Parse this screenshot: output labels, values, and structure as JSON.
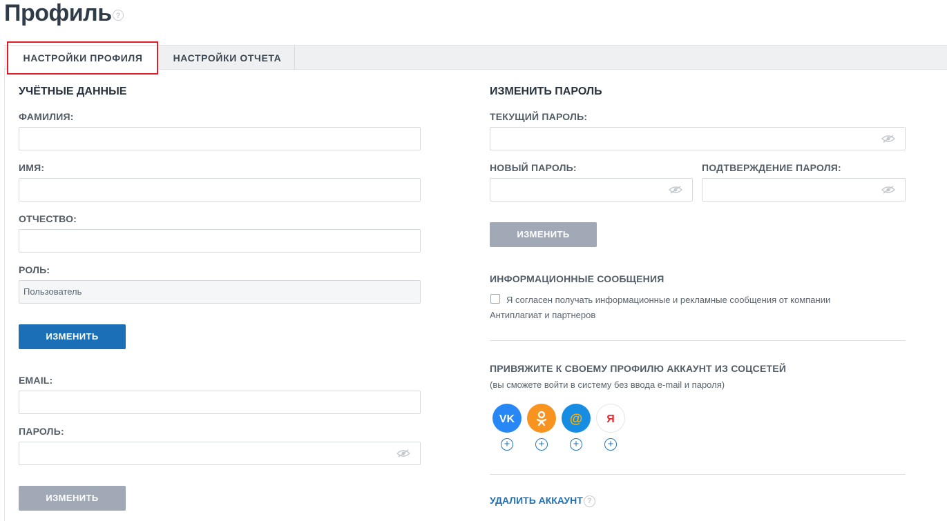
{
  "page": {
    "title": "Профиль",
    "help": "?"
  },
  "tabs": [
    {
      "label": "НАСТРОЙКИ ПРОФИЛЯ",
      "active": true
    },
    {
      "label": "НАСТРОЙКИ ОТЧЕТА",
      "active": false
    }
  ],
  "account": {
    "heading": "УЧЁТНЫЕ ДАННЫЕ",
    "surname_label": "ФАМИЛИЯ:",
    "surname_value": "",
    "name_label": "ИМЯ:",
    "name_value": "",
    "patronymic_label": "ОТЧЕСТВО:",
    "patronymic_value": "",
    "role_label": "РОЛЬ:",
    "role_value": "Пользователь",
    "change_button": "ИЗМЕНИТЬ",
    "email_label": "EMAIL:",
    "email_value": "",
    "password_label": "ПАРОЛЬ:",
    "password_value": "",
    "change_button_2": "ИЗМЕНИТЬ"
  },
  "change_password": {
    "heading": "ИЗМЕНИТЬ ПАРОЛЬ",
    "current_label": "ТЕКУЩИЙ ПАРОЛЬ:",
    "new_label": "НОВЫЙ ПАРОЛЬ:",
    "confirm_label": "ПОДТВЕРЖДЕНИЕ ПАРОЛЯ:",
    "button": "ИЗМЕНИТЬ"
  },
  "info_messages": {
    "heading": "ИНФОРМАЦИОННЫЕ СООБЩЕНИЯ",
    "consent": "Я согласен получать информационные и рекламные сообщения от компании Антиплагиат и партнеров",
    "checked": false
  },
  "social": {
    "heading": "ПРИВЯЖИТЕ К СВОЕМУ ПРОФИЛЮ АККАУНТ ИЗ СОЦСЕТЕЙ",
    "note": "(вы сможете войти в систему без ввода e-mail и пароля)",
    "networks": [
      {
        "icon": "vk-icon",
        "glyph": "VK",
        "color": "#2787f5"
      },
      {
        "icon": "odnoklassniki-icon",
        "glyph": "ok",
        "color": "#f7931e"
      },
      {
        "icon": "mailru-icon",
        "glyph": "@",
        "color": "#168de2"
      },
      {
        "icon": "yandex-icon",
        "glyph": "Я",
        "color": "#ffffff"
      }
    ],
    "add": "+"
  },
  "delete_account": {
    "label": "УДАЛИТЬ АККАУНТ",
    "help": "?"
  },
  "colors": {
    "primary": "#1a6fb6",
    "disabled": "#a0a9b5",
    "highlight": "#dc1f26",
    "link": "#1f6fb2"
  }
}
